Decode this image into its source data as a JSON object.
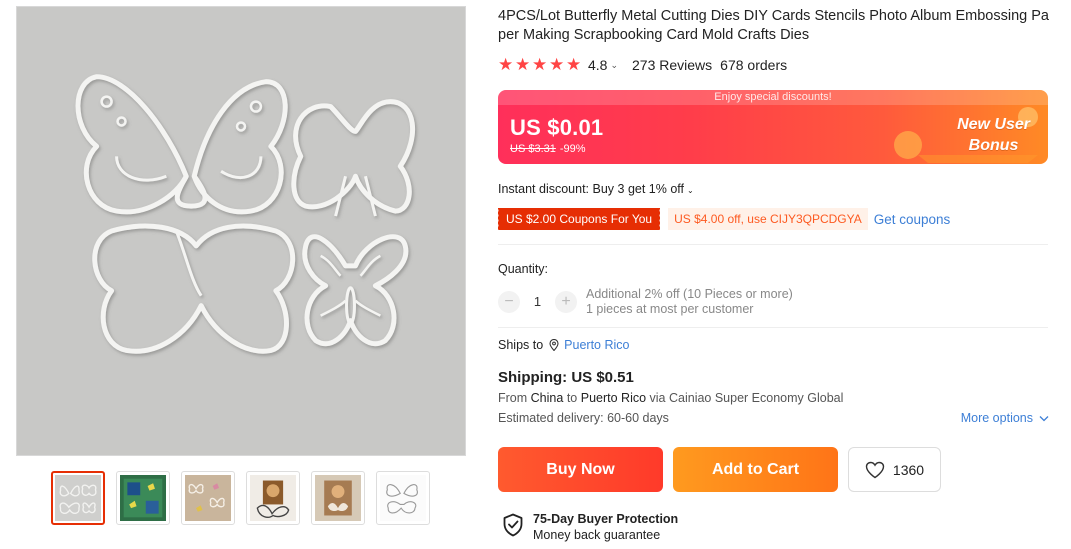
{
  "product": {
    "title": "4PCS/Lot Butterfly Metal Cutting Dies DIY Cards Stencils Photo Album Embossing Paper Making Scrapbooking Card Mold Crafts Dies",
    "rating": "4.8",
    "reviews": "273 Reviews",
    "orders": "678 orders"
  },
  "price": {
    "banner_note": "Enjoy special discounts!",
    "current": "US $0.01",
    "original": "US $3.31",
    "discount": "-99%",
    "bonus_line1": "New User",
    "bonus_line2": "Bonus"
  },
  "discounts": {
    "instant": "Instant discount: Buy 3 get 1% off",
    "coupon_red": "US $2.00 Coupons For You",
    "coupon_orange": "US $4.00 off, use CIJY3QPCDGYA",
    "get_coupons": "Get coupons"
  },
  "quantity": {
    "label": "Quantity:",
    "value": "1",
    "note_line1": "Additional 2% off (10 Pieces or more)",
    "note_line2": "1 pieces at most per customer"
  },
  "shipping": {
    "ships_to_label": "Ships to",
    "ships_to_place": "Puerto Rico",
    "title": "Shipping: US $0.51",
    "route_prefix": "From",
    "route_from": "China",
    "route_to_word": "to",
    "route_to": "Puerto Rico",
    "route_via": "via Cainiao Super Economy Global",
    "delivery": "Estimated delivery: 60-60 days",
    "more_options": "More options"
  },
  "actions": {
    "buy_now": "Buy Now",
    "add_to_cart": "Add to Cart",
    "wishlist_count": "1360"
  },
  "protection": {
    "title": "75-Day Buyer Protection",
    "subtitle": "Money back guarantee"
  },
  "colors": {
    "accent": "#e62e04",
    "link": "#3d7fd6",
    "star": "#ff4444"
  },
  "icons": [
    "star-icon",
    "caret-down-icon",
    "location-pin-icon",
    "chevron-down-icon",
    "heart-icon",
    "shield-check-icon"
  ]
}
